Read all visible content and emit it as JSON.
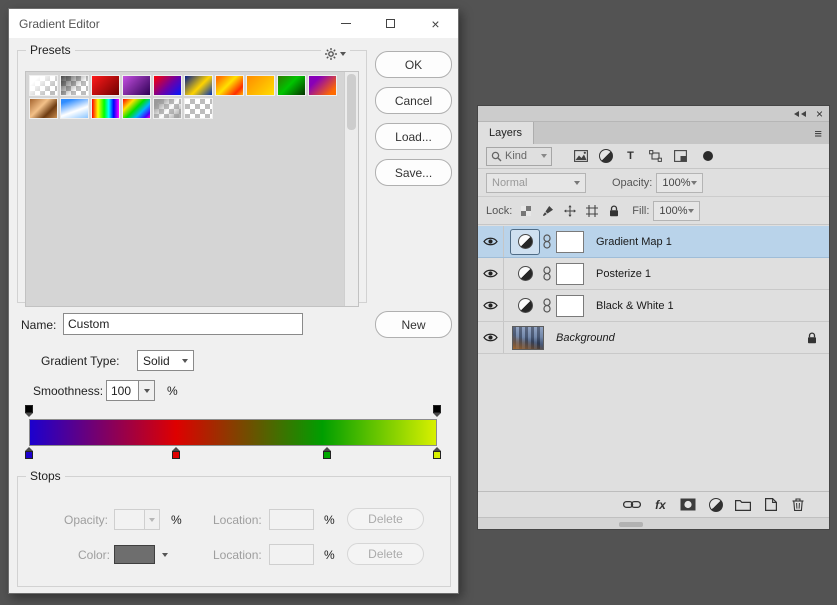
{
  "colors": {
    "desktop_background": "#535353",
    "selection_blue": "#b9d3ea",
    "dialog_background": "#f0f0f0",
    "panel_background": "#dfdfdf"
  },
  "window_icons": {
    "close_glyph": "×"
  },
  "gradient_editor": {
    "title": "Gradient Editor",
    "presets": {
      "label": "Presets",
      "swatches": [
        {
          "name": "white-to-transparent",
          "gradient": "linear-gradient(135deg, #ffffff 20%, rgba(255,255,255,0) 80%)",
          "checker": true
        },
        {
          "name": "black-to-transparent",
          "gradient": "linear-gradient(135deg, rgba(40,40,40,0.85), rgba(40,40,40,0) 65%)",
          "checker": true
        },
        {
          "name": "red-to-dark-red",
          "gradient": "linear-gradient(135deg, #ff1a1a, #6e0000)",
          "checker": false
        },
        {
          "name": "violet-to-dark-violet",
          "gradient": "linear-gradient(135deg, #c44fe0, #2d0054)",
          "checker": false
        },
        {
          "name": "red-to-blue",
          "gradient": "linear-gradient(135deg, #ff0000, #6a00a8 55%, #0018ff)",
          "checker": false
        },
        {
          "name": "blue-yellow-blue",
          "gradient": "linear-gradient(135deg, #001a8c, #ffd400 55%, #0030b4)",
          "checker": false
        },
        {
          "name": "orange-yellow-red",
          "gradient": "linear-gradient(135deg, #ff7300 10%, #ffe100 45%, #ff2d00 80%, #ffae00)",
          "checker": false
        },
        {
          "name": "orange-to-yellow",
          "gradient": "linear-gradient(135deg, #ff8c00, #ffdd00)",
          "checker": false
        },
        {
          "name": "green-to-dark-green",
          "gradient": "linear-gradient(135deg, #2f7a00, #00c400 45%, #063000)",
          "checker": false
        },
        {
          "name": "violet-to-orange",
          "gradient": "linear-gradient(135deg, #8800b8 25%, #ff6a00 85%)",
          "checker": false
        },
        {
          "name": "copper",
          "gradient": "linear-gradient(135deg, #a5652f, #f3c189 40%, #6e3c12 70%, #c98e50)",
          "checker": false
        },
        {
          "name": "blue-to-white",
          "gradient": "linear-gradient(160deg, #2e8cff 15%, #ffffff 60%, #8cc6ff)",
          "checker": false
        },
        {
          "name": "spectrum",
          "gradient": "linear-gradient(90deg, #ff0000, #ffff00 22%, #00ff00 45%, #00ffff 62%, #0000ff 80%, #ff00ff)",
          "checker": false
        },
        {
          "name": "spectrum-diagonal",
          "gradient": "linear-gradient(135deg, #ff0000, #ffe000 25%, #00e000 48%, #00b4ff 68%, #4600ff 88%, #ff00c8)",
          "checker": false
        },
        {
          "name": "gray-to-transparent",
          "gradient": "linear-gradient(135deg, #9a9a9a 15%, rgba(154,154,154,0) 55%, rgba(154,154,154,0.8) 90%)",
          "checker": true
        },
        {
          "name": "transparent",
          "gradient": "",
          "checker": true
        }
      ]
    },
    "buttons": {
      "ok": "OK",
      "cancel": "Cancel",
      "load": "Load...",
      "save": "Save...",
      "new": "New"
    },
    "name_field": {
      "label": "Name:",
      "value": "Custom"
    },
    "gradient_type": {
      "label": "Gradient Type:",
      "value": "Solid"
    },
    "smoothness": {
      "label": "Smoothness:",
      "value": "100",
      "unit": "%"
    },
    "gradient_bar": {
      "css": "linear-gradient(90deg, #1c00ce 0%, #de0000 36%, #009e00 72%, #d8f000 100%)",
      "opacity_stops": [
        {
          "position": 0,
          "color": "#000000"
        },
        {
          "position": 100,
          "color": "#000000"
        }
      ],
      "color_stops": [
        {
          "position": 0,
          "color": "#1c00ce"
        },
        {
          "position": 36,
          "color": "#e00000"
        },
        {
          "position": 73,
          "color": "#00a800"
        },
        {
          "position": 100,
          "color": "#d8f000"
        }
      ]
    },
    "stops_section": {
      "label": "Stops",
      "opacity_label": "Opacity:",
      "location_label": "Location:",
      "color_label": "Color:",
      "unit": "%",
      "delete_label": "Delete"
    }
  },
  "layers_panel": {
    "tab_label": "Layers",
    "filter": {
      "kind_label": "Kind"
    },
    "blend_mode": "Normal",
    "opacity": {
      "label": "Opacity:",
      "value": "100%"
    },
    "lock": {
      "label": "Lock:"
    },
    "fill": {
      "label": "Fill:",
      "value": "100%"
    },
    "layers": [
      {
        "name": "Gradient Map 1",
        "type": "adjustment",
        "selected": true,
        "linked": true,
        "mask": true
      },
      {
        "name": "Posterize 1",
        "type": "adjustment",
        "selected": false,
        "linked": true,
        "mask": true
      },
      {
        "name": "Black & White 1",
        "type": "adjustment",
        "selected": false,
        "linked": true,
        "mask": true
      },
      {
        "name": "Background",
        "type": "image",
        "selected": false,
        "locked": true,
        "italic": true
      }
    ],
    "icons": {
      "type_glyph": "T",
      "fx_glyph": "fx",
      "menu_glyph": "≡",
      "close_glyph": "×"
    }
  }
}
